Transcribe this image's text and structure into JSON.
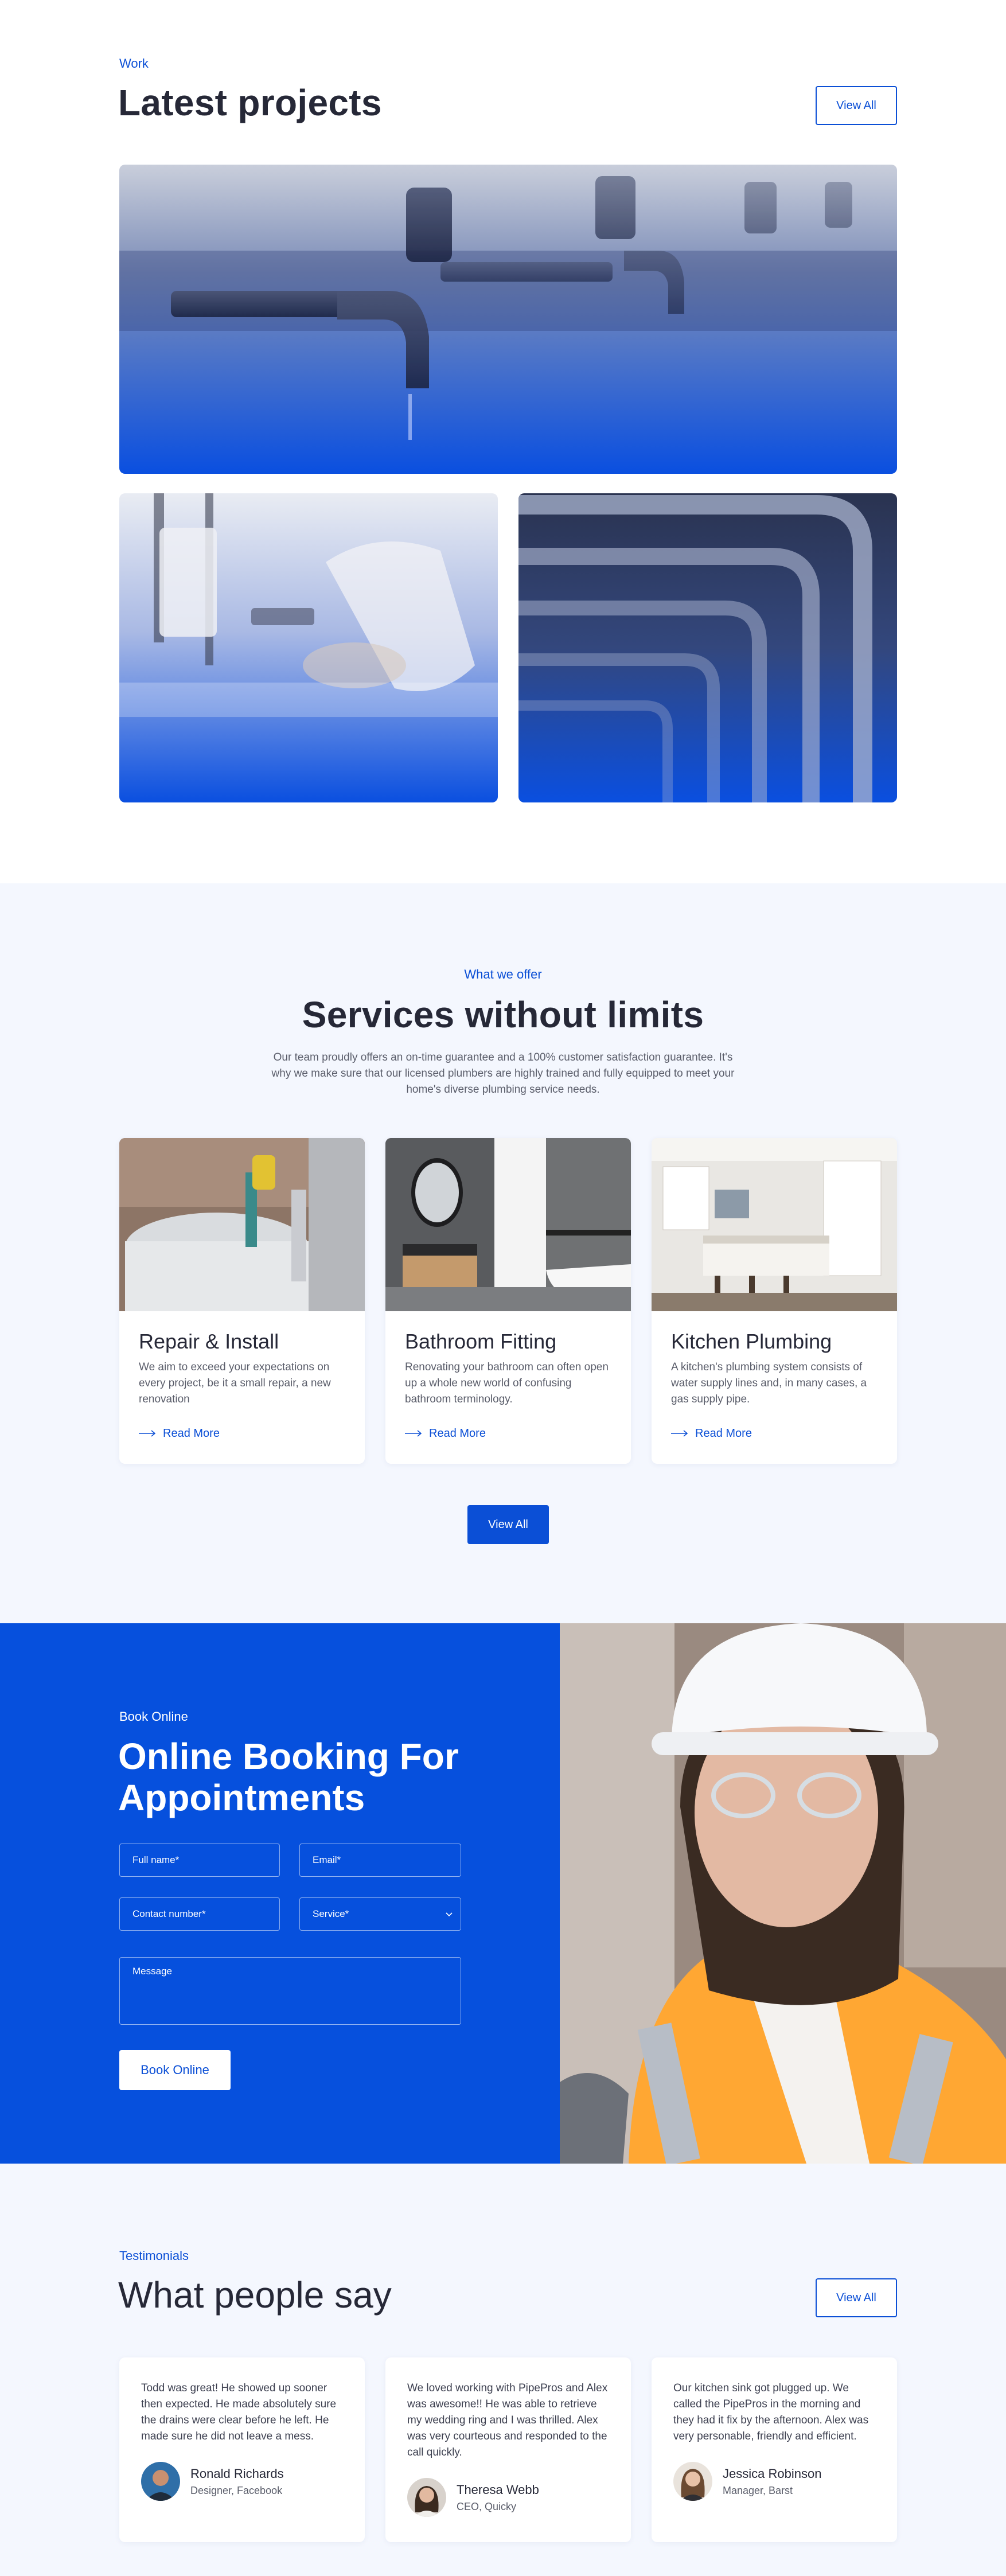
{
  "projects": {
    "eyebrow": "Work",
    "title": "Latest projects",
    "view_all": "View All"
  },
  "services": {
    "eyebrow": "What we offer",
    "title": "Services without limits",
    "lead_line1": "Our team proudly offers an on-time guarantee and a 100% customer satisfaction guarantee. It's",
    "lead_line2": "why we make sure that our licensed plumbers are highly trained and fully equipped to meet your",
    "lead_line3": "home's diverse plumbing service needs.",
    "cards": [
      {
        "title": "Repair & Install",
        "text": "We aim to exceed your expectations on every project, be it a small repair, a new renovation",
        "link": "Read More"
      },
      {
        "title": "Bathroom Fitting",
        "text": "Renovating your bathroom can often open up a whole new world of confusing bathroom terminology.",
        "link": "Read More"
      },
      {
        "title": "Kitchen Plumbing",
        "text": "A kitchen's plumbing system consists of water supply lines and, in many cases, a gas supply pipe.",
        "link": "Read More"
      }
    ],
    "view_all": "View All"
  },
  "booking": {
    "eyebrow": "Book Online",
    "title_line1": "Online Booking For",
    "title_line2": "Appointments",
    "full_name": "Full name*",
    "email": "Email*",
    "contact": "Contact number*",
    "service": "Service*",
    "message": "Message",
    "submit": "Book Online"
  },
  "testimonials": {
    "eyebrow": "Testimonials",
    "title": "What people say",
    "view_all": "View All",
    "items": [
      {
        "text": "Todd was great! He showed up sooner then expected. He made absolutely sure the drains were clear before he left. He made sure he did not leave a mess.",
        "name": "Ronald Richards",
        "role": "Designer, Facebook"
      },
      {
        "text": "We loved working with PipePros and Alex was awesome!! He was able to retrieve my wedding ring and I was thrilled. Alex was very courteous and responded to the call quickly.",
        "name": "Theresa Webb",
        "role": "CEO, Quicky"
      },
      {
        "text": "Our kitchen sink got plugged up. We called the PipePros in the morning and they had it fix by the afternoon. Alex was very personable, friendly and efficient.",
        "name": "Jessica Robinson",
        "role": "Manager, Barst"
      }
    ]
  },
  "colors": {
    "accent": "#0b4fd6",
    "booking_bg": "#0650dd",
    "soft_bg": "#f4f7fe",
    "heading": "#262837"
  }
}
